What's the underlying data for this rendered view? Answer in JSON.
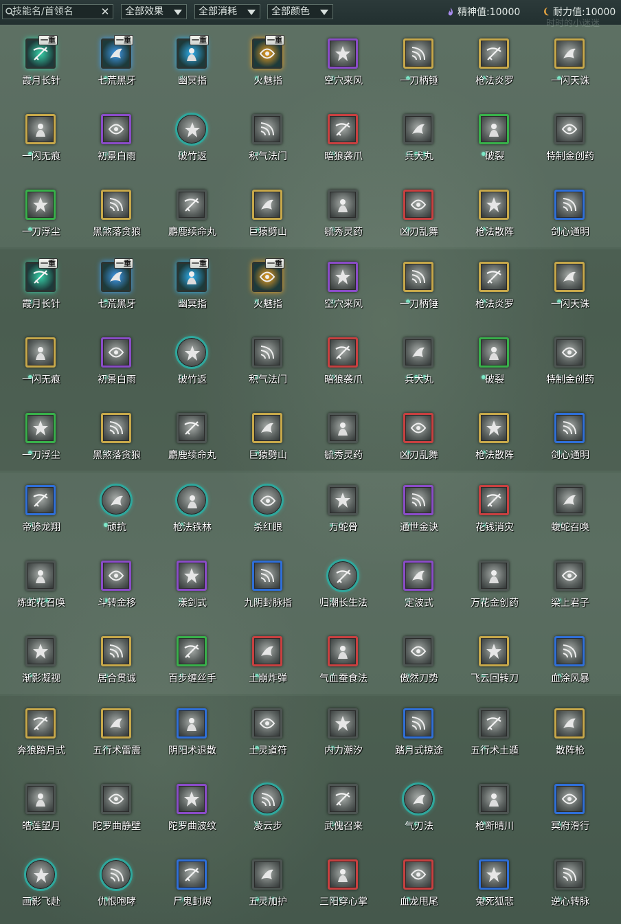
{
  "toolbar": {
    "search_placeholder": "技能名/首领名",
    "clear_label": "✕",
    "filter_effect": "全部效果",
    "filter_cost": "全部消耗",
    "filter_color": "全部颜色",
    "spirit_label": "精神值:",
    "spirit_value": "10000",
    "endurance_label": "耐力值:",
    "endurance_value": "10000",
    "watermark": "时时的小迷迷"
  },
  "colors": {
    "gold": "#c7a84a",
    "purple": "#8a4cc8",
    "green": "#38b04a",
    "blue": "#2f6fd8",
    "red": "#c84040",
    "teal": "#2fa79c",
    "grey": "#4d5552",
    "dot": "#7ee8c8"
  },
  "tier_label": "一重",
  "skills": [
    {
      "name": "霞月长针",
      "frame": "plain",
      "tier": true,
      "dots": 1,
      "glow": "#36d0a8"
    },
    {
      "name": "七荒黑牙",
      "frame": "plain",
      "tier": true,
      "dots": 1,
      "glow": "#3f9cf0"
    },
    {
      "name": "幽冥指",
      "frame": "plain",
      "tier": true,
      "dots": 1,
      "glow": "#2fb0f0"
    },
    {
      "name": "火魅指",
      "frame": "plain",
      "tier": true,
      "dots": 1,
      "glow": "#f0a020"
    },
    {
      "name": "空穴来风",
      "frame": "purple",
      "dots": 1
    },
    {
      "name": "一刀柄锤",
      "frame": "gold",
      "dots": 1
    },
    {
      "name": "枪法炎罗",
      "frame": "gold",
      "dots": 1
    },
    {
      "name": "一闪天诛",
      "frame": "gold",
      "dots": 1
    },
    {
      "name": "一闪无痕",
      "frame": "gold",
      "dots": 1
    },
    {
      "name": "初景白雨",
      "frame": "purple",
      "dots": 1
    },
    {
      "name": "破竹返",
      "frame": "round",
      "dots": 1
    },
    {
      "name": "积气法门",
      "frame": "grey",
      "dots": 1
    },
    {
      "name": "暗狼袭爪",
      "frame": "red",
      "dots": 1
    },
    {
      "name": "兵犬丸",
      "frame": "grey",
      "dots": 3
    },
    {
      "name": "破裂",
      "frame": "green",
      "dots": 1
    },
    {
      "name": "特制金创药",
      "frame": "grey",
      "dots": 1
    },
    {
      "name": "一刀浮尘",
      "frame": "green",
      "dots": 1
    },
    {
      "name": "黑煞落贪狼",
      "frame": "gold",
      "dots": 1
    },
    {
      "name": "麝鹿续命丸",
      "frame": "grey",
      "dots": 1
    },
    {
      "name": "巨猿劈山",
      "frame": "gold",
      "dots": 1
    },
    {
      "name": "毓秀灵药",
      "frame": "grey",
      "dots": 1
    },
    {
      "name": "凶刃乱舞",
      "frame": "red",
      "dots": 1
    },
    {
      "name": "枪法散阵",
      "frame": "gold",
      "dots": 1
    },
    {
      "name": "剑心通明",
      "frame": "blue",
      "dots": 1
    },
    {
      "name": "霞月长针",
      "frame": "plain",
      "tier": true,
      "dots": 1,
      "glow": "#36d0a8"
    },
    {
      "name": "七荒黑牙",
      "frame": "plain",
      "tier": true,
      "dots": 1,
      "glow": "#3f9cf0"
    },
    {
      "name": "幽冥指",
      "frame": "plain",
      "tier": true,
      "dots": 1,
      "glow": "#2fb0f0"
    },
    {
      "name": "火魅指",
      "frame": "plain",
      "tier": true,
      "dots": 1,
      "glow": "#f0a020"
    },
    {
      "name": "空穴来风",
      "frame": "purple",
      "dots": 1
    },
    {
      "name": "一刀柄锤",
      "frame": "gold",
      "dots": 1
    },
    {
      "name": "枪法炎罗",
      "frame": "gold",
      "dots": 1
    },
    {
      "name": "一闪天诛",
      "frame": "gold",
      "dots": 1
    },
    {
      "name": "一闪无痕",
      "frame": "gold",
      "dots": 1
    },
    {
      "name": "初景白雨",
      "frame": "purple",
      "dots": 1
    },
    {
      "name": "破竹返",
      "frame": "round",
      "dots": 1
    },
    {
      "name": "积气法门",
      "frame": "grey",
      "dots": 1
    },
    {
      "name": "暗狼袭爪",
      "frame": "red",
      "dots": 1
    },
    {
      "name": "兵犬丸",
      "frame": "grey",
      "dots": 3
    },
    {
      "name": "破裂",
      "frame": "green",
      "dots": 1
    },
    {
      "name": "特制金创药",
      "frame": "grey",
      "dots": 1
    },
    {
      "name": "一刀浮尘",
      "frame": "green",
      "dots": 1
    },
    {
      "name": "黑煞落贪狼",
      "frame": "gold",
      "dots": 1
    },
    {
      "name": "麝鹿续命丸",
      "frame": "grey",
      "dots": 1
    },
    {
      "name": "巨猿劈山",
      "frame": "gold",
      "dots": 1
    },
    {
      "name": "毓秀灵药",
      "frame": "grey",
      "dots": 1
    },
    {
      "name": "凶刃乱舞",
      "frame": "red",
      "dots": 1
    },
    {
      "name": "枪法散阵",
      "frame": "gold",
      "dots": 1
    },
    {
      "name": "剑心通明",
      "frame": "blue",
      "dots": 1
    },
    {
      "name": "帝骖龙翔",
      "frame": "blue",
      "dots": 1
    },
    {
      "name": "顽抗",
      "frame": "round",
      "dots": 1
    },
    {
      "name": "枪法铁林",
      "frame": "round",
      "dots": 1
    },
    {
      "name": "杀红眼",
      "frame": "round",
      "dots": 1
    },
    {
      "name": "万蛇骨",
      "frame": "grey",
      "dots": 2
    },
    {
      "name": "通世金诀",
      "frame": "purple",
      "dots": 1
    },
    {
      "name": "花钱消灾",
      "frame": "red",
      "dots": 1
    },
    {
      "name": "蝮蛇召唤",
      "frame": "grey",
      "dots": 1
    },
    {
      "name": "炼蛇花召唤",
      "frame": "grey",
      "dots": 3
    },
    {
      "name": "斗转金移",
      "frame": "purple",
      "dots": 1
    },
    {
      "name": "漾剑式",
      "frame": "purple",
      "dots": 1
    },
    {
      "name": "九阴封脉指",
      "frame": "blue",
      "dots": 1
    },
    {
      "name": "归潮长生法",
      "frame": "round",
      "dots": 1
    },
    {
      "name": "定波式",
      "frame": "purple",
      "dots": 1
    },
    {
      "name": "万花金创药",
      "frame": "grey",
      "dots": 1
    },
    {
      "name": "梁上君子",
      "frame": "grey",
      "dots": 1
    },
    {
      "name": "渐影凝视",
      "frame": "grey",
      "dots": 1
    },
    {
      "name": "居合贯诚",
      "frame": "gold",
      "dots": 1
    },
    {
      "name": "百步缠丝手",
      "frame": "green",
      "dots": 1
    },
    {
      "name": "土崩炸弹",
      "frame": "red",
      "dots": 1
    },
    {
      "name": "气血蚕食法",
      "frame": "red",
      "dots": 1
    },
    {
      "name": "傲然刀势",
      "frame": "grey",
      "dots": 1
    },
    {
      "name": "飞云回转刀",
      "frame": "gold",
      "dots": 1
    },
    {
      "name": "血涂风暴",
      "frame": "blue",
      "dots": 1
    },
    {
      "name": "奔狼踏月式",
      "frame": "gold",
      "dots": 1
    },
    {
      "name": "五行术雷震",
      "frame": "gold",
      "dots": 1
    },
    {
      "name": "阴阳术退散",
      "frame": "blue",
      "dots": 1
    },
    {
      "name": "土灵道符",
      "frame": "grey",
      "dots": 1
    },
    {
      "name": "内力潮汐",
      "frame": "grey",
      "dots": 1
    },
    {
      "name": "踏月式掠途",
      "frame": "blue",
      "dots": 1
    },
    {
      "name": "五行术土遁",
      "frame": "grey",
      "dots": 1
    },
    {
      "name": "散阵枪",
      "frame": "gold",
      "dots": 1
    },
    {
      "name": "皓莲望月",
      "frame": "grey",
      "dots": 1
    },
    {
      "name": "陀罗曲静壁",
      "frame": "grey",
      "dots": 1
    },
    {
      "name": "陀罗曲波纹",
      "frame": "purple",
      "dots": 1
    },
    {
      "name": "凌云步",
      "frame": "round",
      "dots": 1
    },
    {
      "name": "武傀召来",
      "frame": "grey",
      "dots": 2
    },
    {
      "name": "气刃法",
      "frame": "round",
      "dots": 2
    },
    {
      "name": "枪断晴川",
      "frame": "grey",
      "dots": 1
    },
    {
      "name": "冥府滑行",
      "frame": "blue",
      "dots": 1
    },
    {
      "name": "画影飞赴",
      "frame": "round",
      "dots": 1
    },
    {
      "name": "仇恨咆哮",
      "frame": "round",
      "dots": 1
    },
    {
      "name": "尸鬼封烬",
      "frame": "blue",
      "dots": 1
    },
    {
      "name": "五灵加护",
      "frame": "grey",
      "dots": 3
    },
    {
      "name": "三阳穿心掌",
      "frame": "red",
      "dots": 2
    },
    {
      "name": "血龙甩尾",
      "frame": "red",
      "dots": 1
    },
    {
      "name": "兔死狐悲",
      "frame": "blue",
      "dots": 1
    },
    {
      "name": "逆心转脉",
      "frame": "grey",
      "dots": 1
    }
  ]
}
